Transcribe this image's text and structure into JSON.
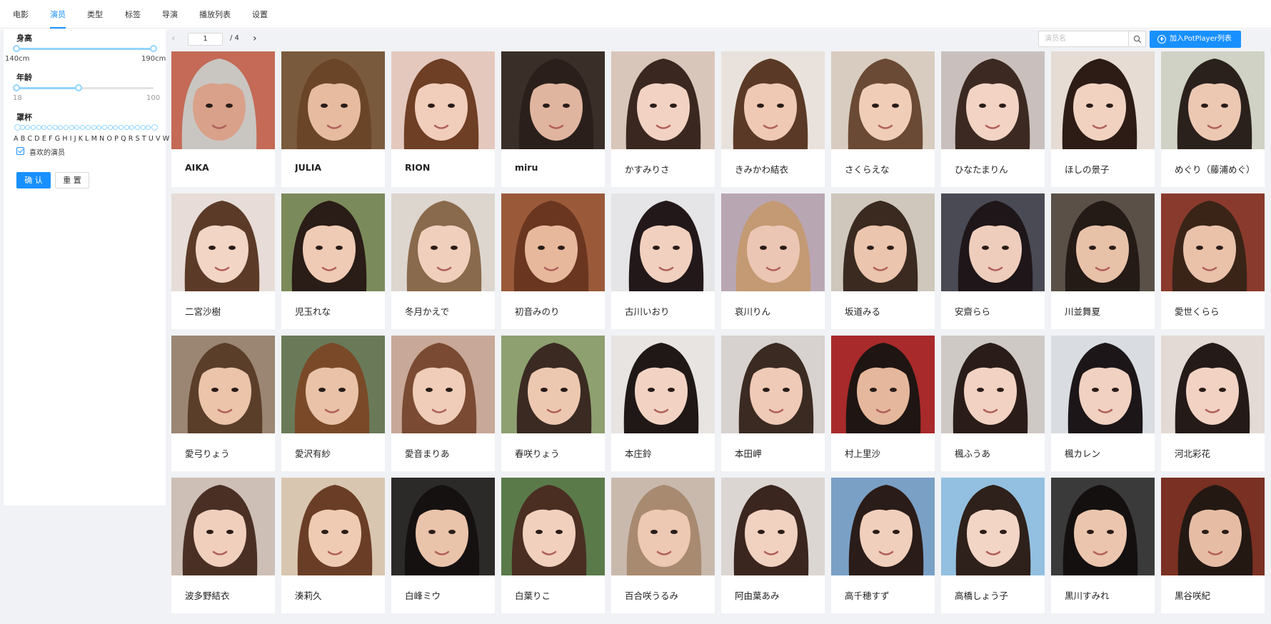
{
  "nav": {
    "tabs": [
      {
        "label": "电影"
      },
      {
        "label": "演员",
        "active": true
      },
      {
        "label": "类型"
      },
      {
        "label": "标签"
      },
      {
        "label": "导演"
      },
      {
        "label": "播放列表"
      },
      {
        "label": "设置"
      }
    ]
  },
  "filters": {
    "height": {
      "title": "身高",
      "min_label": "140cm",
      "max_label": "190cm",
      "range": [
        140,
        190
      ],
      "selected": [
        140,
        190
      ]
    },
    "age": {
      "title": "年龄",
      "min_label": "18",
      "max_label": "100",
      "range": [
        18,
        100
      ],
      "selected": [
        18,
        55
      ]
    },
    "cup": {
      "title": "罩杯",
      "letters": "A B C D E F G H I J K L M N O P Q R S T U V W X Y Z"
    },
    "favorite": {
      "label": "喜欢的演员",
      "checked": true
    },
    "confirm_label": "确 认",
    "reset_label": "重 置"
  },
  "toolbar": {
    "prev_icon": "chevron-left-icon",
    "next_icon": "chevron-right-icon",
    "page": "1",
    "total": "/ 4",
    "search_placeholder": "演员名",
    "search_icon": "search-icon",
    "add_label": "加入PotPlayer列表",
    "add_icon": "plus-circle-icon"
  },
  "colors": {
    "accent": "#1890ff",
    "slider": "#91d5ff",
    "background": "#f0f2f5"
  },
  "actors": [
    {
      "name": "AIKA",
      "bold": true,
      "bg": "#c46a56",
      "skin": "#d9a18a",
      "hair": "#c9c6c2"
    },
    {
      "name": "JULIA",
      "bold": true,
      "bg": "#7a5a3c",
      "skin": "#e6bba0",
      "hair": "#6b4528"
    },
    {
      "name": "RION",
      "bold": true,
      "bg": "#e4c8be",
      "skin": "#f1cdbb",
      "hair": "#6e3e25"
    },
    {
      "name": "miru",
      "bold": true,
      "bg": "#3a2e28",
      "skin": "#e0b59f",
      "hair": "#2a1f1a"
    },
    {
      "name": "かすみりさ",
      "bg": "#d9c6ba",
      "skin": "#f2d2c2",
      "hair": "#3a2720"
    },
    {
      "name": "きみかわ結衣",
      "bg": "#e9e2dc",
      "skin": "#efc9b3",
      "hair": "#5a3a26"
    },
    {
      "name": "さくらえな",
      "bg": "#d8ccc0",
      "skin": "#f0cdb7",
      "hair": "#6a4a34"
    },
    {
      "name": "ひなたまりん",
      "bg": "#c9c0bd",
      "skin": "#f2d3c4",
      "hair": "#3c2a22"
    },
    {
      "name": "ほしの景子",
      "bg": "#e6dcd4",
      "skin": "#f1d2c0",
      "hair": "#2d1c16"
    },
    {
      "name": "めぐり（藤浦めぐ）",
      "bg": "#cfd2c4",
      "skin": "#ecc8b3",
      "hair": "#2b211c"
    },
    {
      "name": "二宮沙樹",
      "bg": "#e7dcd7",
      "skin": "#f3d5c6",
      "hair": "#5b3a28"
    },
    {
      "name": "児玉れな",
      "bg": "#7b8a5a",
      "skin": "#efcbb5",
      "hair": "#2a1c16"
    },
    {
      "name": "冬月かえで",
      "bg": "#ddd6cf",
      "skin": "#f0cfbc",
      "hair": "#8a6a4c"
    },
    {
      "name": "初音みのり",
      "bg": "#9a5a3a",
      "skin": "#e8b89c",
      "hair": "#6a3620"
    },
    {
      "name": "古川いおり",
      "bg": "#e5e4e6",
      "skin": "#f1d0bf",
      "hair": "#22181a"
    },
    {
      "name": "哀川りん",
      "bg": "#b9a6b3",
      "skin": "#ecc6b4",
      "hair": "#c39a73"
    },
    {
      "name": "坂道みる",
      "bg": "#cfc7bc",
      "skin": "#ebc5ad",
      "hair": "#3a2a20"
    },
    {
      "name": "安齋らら",
      "bg": "#4a4a55",
      "skin": "#efcdbd",
      "hair": "#1e1618"
    },
    {
      "name": "川並舞夏",
      "bg": "#5a5048",
      "skin": "#e8c1a9",
      "hair": "#241a16"
    },
    {
      "name": "愛世くらら",
      "bg": "#8a3a2c",
      "skin": "#eac2aa",
      "hair": "#3a2418"
    },
    {
      "name": "愛弓りょう",
      "bg": "#9a8672",
      "skin": "#ebc4aa",
      "hair": "#5a3e2a"
    },
    {
      "name": "愛沢有紗",
      "bg": "#6a7a58",
      "skin": "#e9c2a8",
      "hair": "#7a4a28"
    },
    {
      "name": "愛音まりあ",
      "bg": "#c8a898",
      "skin": "#f0cdb8",
      "hair": "#7a4a32"
    },
    {
      "name": "春咲りょう",
      "bg": "#8ea070",
      "skin": "#edc8b1",
      "hair": "#3a2a22"
    },
    {
      "name": "本庄鈴",
      "bg": "#e8e4e2",
      "skin": "#f2d3c3",
      "hair": "#1f1817"
    },
    {
      "name": "本田岬",
      "bg": "#d7d2cf",
      "skin": "#efcab6",
      "hair": "#3b2a22"
    },
    {
      "name": "村上里沙",
      "bg": "#a82a2a",
      "skin": "#e5b79c",
      "hair": "#1f1512"
    },
    {
      "name": "楓ふうあ",
      "bg": "#cfc9c6",
      "skin": "#f2d2c2",
      "hair": "#2a1d19"
    },
    {
      "name": "楓カレン",
      "bg": "#d9dde2",
      "skin": "#f1d1c1",
      "hair": "#1c1618"
    },
    {
      "name": "河北彩花",
      "bg": "#e3dad5",
      "skin": "#f2d2c3",
      "hair": "#241a18"
    },
    {
      "name": "波多野結衣",
      "bg": "#cdbfb6",
      "skin": "#f0cfbd",
      "hair": "#4a3024"
    },
    {
      "name": "湊莉久",
      "bg": "#d9c6b0",
      "skin": "#efcbb3",
      "hair": "#6a3e26"
    },
    {
      "name": "白峰ミウ",
      "bg": "#2c2a28",
      "skin": "#e9c3aa",
      "hair": "#151111"
    },
    {
      "name": "白葉りこ",
      "bg": "#5a7a4a",
      "skin": "#f1d0bd",
      "hair": "#4a2e22"
    },
    {
      "name": "百合咲うるみ",
      "bg": "#c9b9ad",
      "skin": "#edc8b2",
      "hair": "#a88a70"
    },
    {
      "name": "阿由葉あみ",
      "bg": "#dcd6d3",
      "skin": "#f1d1c0",
      "hair": "#3a261e"
    },
    {
      "name": "高千穂すず",
      "bg": "#7aa0c6",
      "skin": "#f0cfbc",
      "hair": "#2a1c18"
    },
    {
      "name": "高橋しょう子",
      "bg": "#93c0e0",
      "skin": "#f3d5c6",
      "hair": "#2e201a"
    },
    {
      "name": "黒川すみれ",
      "bg": "#3a3a3a",
      "skin": "#ebc5ad",
      "hair": "#141010"
    },
    {
      "name": "黒谷咲紀",
      "bg": "#7a3022",
      "skin": "#e6bda4",
      "hair": "#241813"
    }
  ]
}
